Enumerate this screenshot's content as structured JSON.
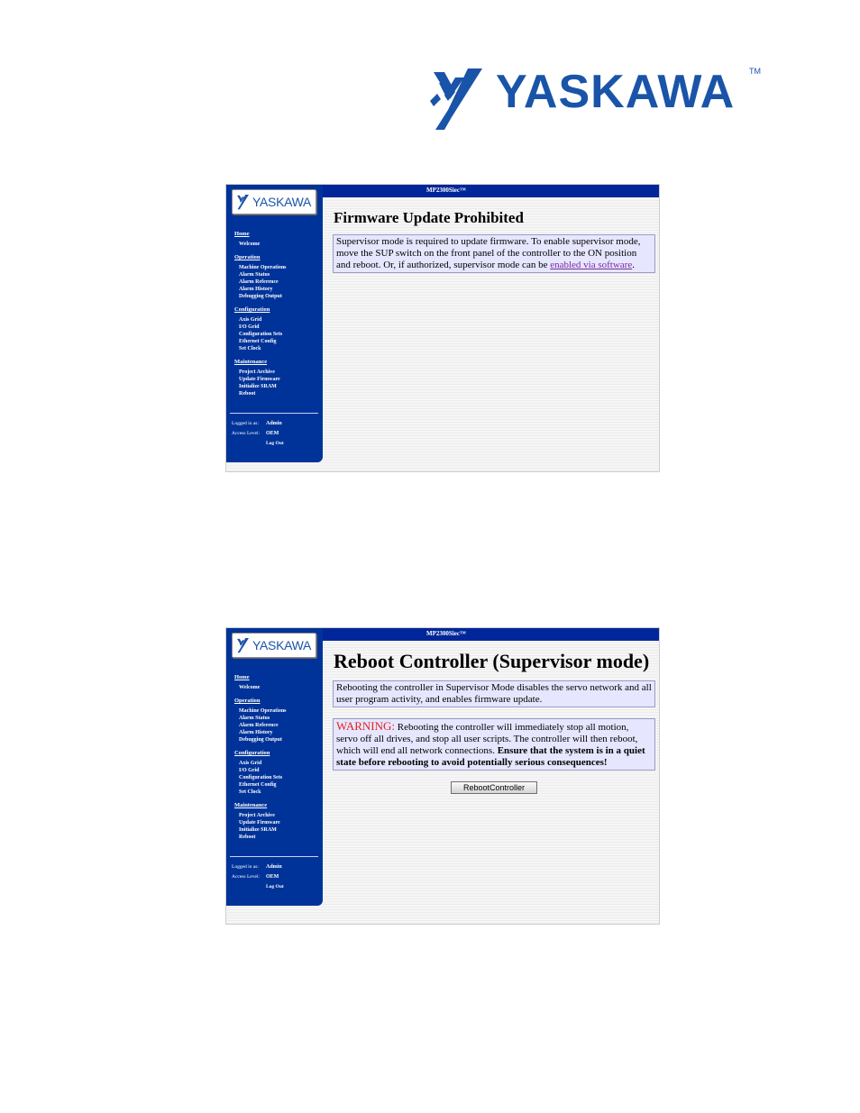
{
  "brand": {
    "name": "YASKAWA",
    "tm": "TM"
  },
  "screens": [
    {
      "product": "MP2300Siec™",
      "logo_text": "YASKAWA",
      "nav": {
        "home": "Home",
        "welcome": "Welcome",
        "operation": "Operation",
        "operation_items": [
          "Machine Operations",
          "Alarm Status",
          "Alarm Reference",
          "Alarm History",
          "Debugging Output"
        ],
        "configuration": "Configuration",
        "configuration_items": [
          "Axis Grid",
          "I/O Grid",
          "Configuration Sets",
          "Ethernet Config",
          "Set Clock"
        ],
        "maintenance": "Maintenance",
        "maintenance_items": [
          "Project Archive",
          "Update Firmware",
          "Initialize SRAM",
          "Reboot"
        ]
      },
      "login": {
        "logged_label": "Logged in as:",
        "user": "Admin",
        "level_label": "Access Level:",
        "level": "OEM",
        "logout": "Log Out"
      },
      "title": "Firmware Update Prohibited",
      "message": "Supervisor mode is required to update firmware. To enable supervisor mode, move the SUP switch on the front panel of the controller to the ON position and reboot. Or, if authorized, supervisor mode can be ",
      "link": "enabled via software",
      "message_end": "."
    },
    {
      "product": "MP2300Siec™",
      "logo_text": "YASKAWA",
      "nav": {
        "home": "Home",
        "welcome": "Welcome",
        "operation": "Operation",
        "operation_items": [
          "Machine Operations",
          "Alarm Status",
          "Alarm Reference",
          "Alarm History",
          "Debugging Output"
        ],
        "configuration": "Configuration",
        "configuration_items": [
          "Axis Grid",
          "I/O Grid",
          "Configuration Sets",
          "Ethernet Config",
          "Set Clock"
        ],
        "maintenance": "Maintenance",
        "maintenance_items": [
          "Project Archive",
          "Update Firmware",
          "Initialize SRAM",
          "Reboot"
        ]
      },
      "login": {
        "logged_label": "Logged in as:",
        "user": "Admin",
        "level_label": "Access Level:",
        "level": "OEM",
        "logout": "Log Out"
      },
      "title": "Reboot Controller (Supervisor mode)",
      "info": "Rebooting the controller in Supervisor Mode disables the servo network and all user program activity, and enables firmware update.",
      "warning_label": "WARNING:",
      "warning_text": " Rebooting the controller will immediately stop all motion, servo off all drives, and stop all user scripts. The controller will then reboot, which will end all network connections. ",
      "warning_bold": "Ensure that the system is in a quiet state before rebooting to avoid potentially serious consequences!",
      "button": "RebootController"
    }
  ]
}
